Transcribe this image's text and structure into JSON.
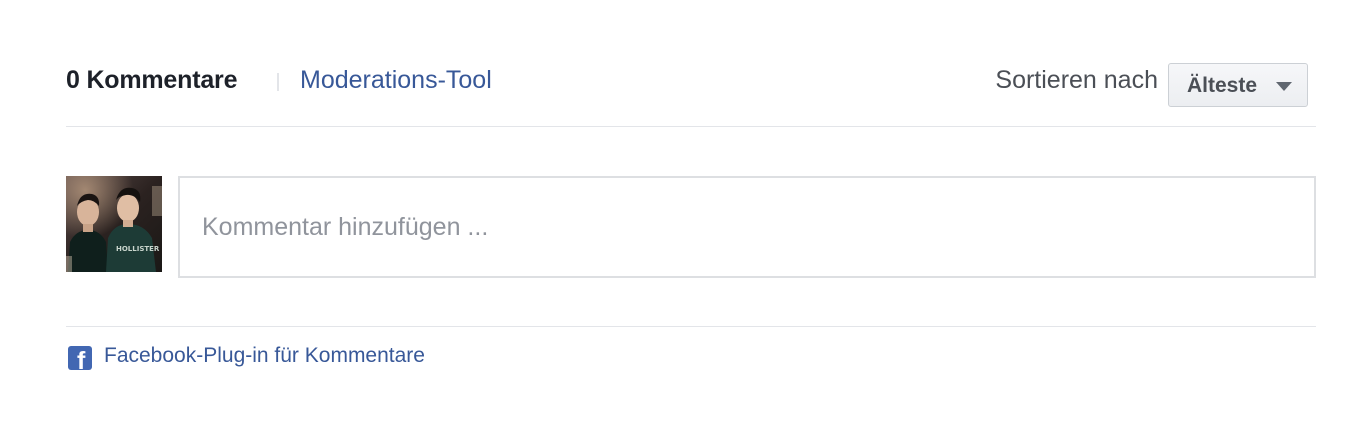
{
  "header": {
    "comment_count": "0 Kommentare",
    "moderation_link": "Moderations-Tool",
    "sort_label": "Sortieren nach",
    "sort_selected": "Älteste"
  },
  "composer": {
    "placeholder": "Kommentar hinzufügen ..."
  },
  "footer": {
    "plugin_link": "Facebook-Plug-in für Kommentare",
    "fb_glyph": "f"
  },
  "colors": {
    "link": "#385898",
    "fb_blue": "#4267b2",
    "text_dark": "#1d2129",
    "text_muted": "#4b4f56",
    "placeholder": "#90949c",
    "border": "#dddfe2"
  },
  "icons": {
    "sort_caret": "chevron-down-icon",
    "facebook": "facebook-icon"
  }
}
